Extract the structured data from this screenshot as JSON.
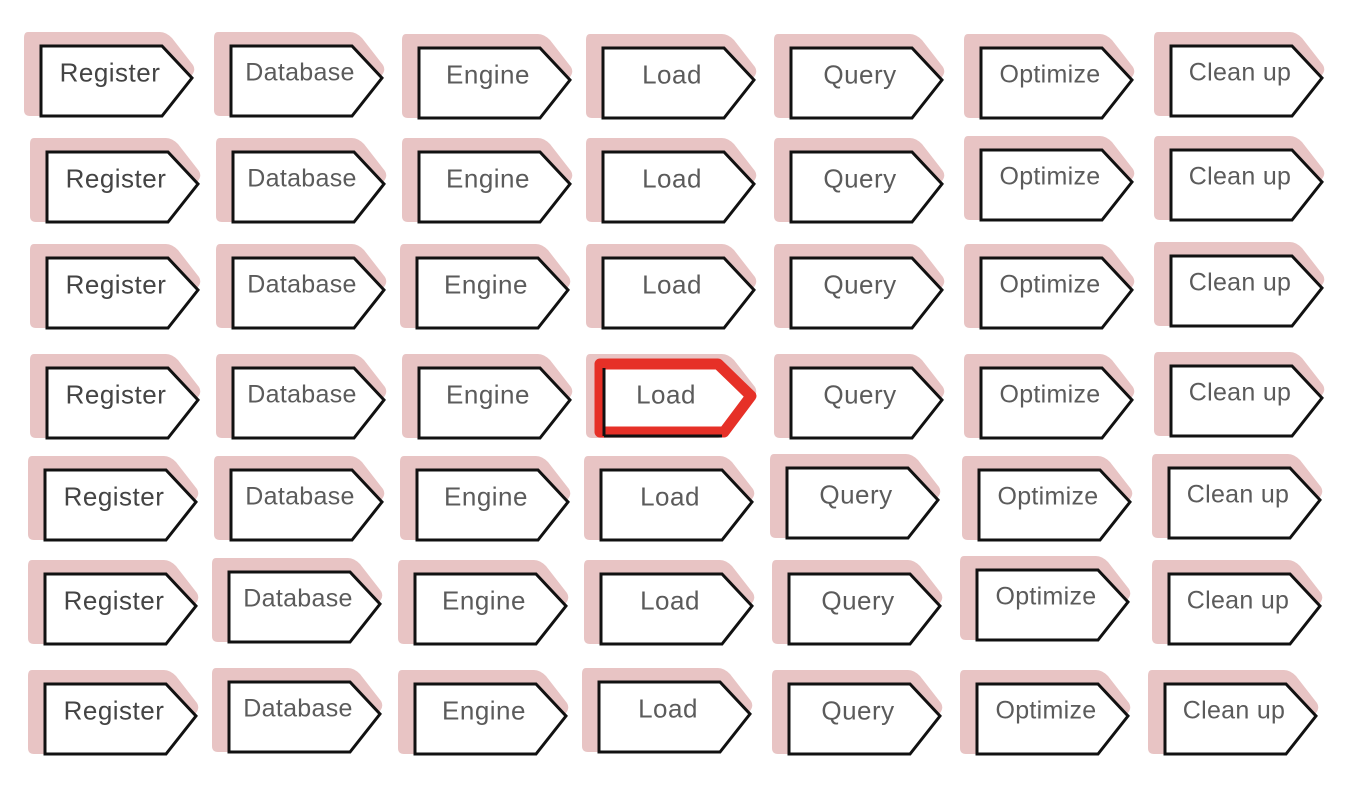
{
  "colors": {
    "shadow": "#e8c4c4",
    "outline": "#111111",
    "selected_outline": "#e63027",
    "label": "#5b5b5b"
  },
  "icon": "pentagon-arrow-tag-icon",
  "columns": [
    "Register",
    "Database",
    "Engine",
    "Load",
    "Query",
    "Optimize",
    "Clean up"
  ],
  "rows": [
    [
      "Register",
      "Database",
      "Engine",
      "Load",
      "Query",
      "Optimize",
      "Clean up"
    ],
    [
      "Register",
      "Database",
      "Engine",
      "Load",
      "Query",
      "Optimize",
      "Clean up"
    ],
    [
      "Register",
      "Database",
      "Engine",
      "Load",
      "Query",
      "Optimize",
      "Clean up"
    ],
    [
      "Register",
      "Database",
      "Engine",
      "Load",
      "Query",
      "Optimize",
      "Clean up"
    ],
    [
      "Register",
      "Database",
      "Engine",
      "Load",
      "Query",
      "Optimize",
      "Clean up"
    ],
    [
      "Register",
      "Database",
      "Engine",
      "Load",
      "Query",
      "Optimize",
      "Clean up"
    ],
    [
      "Register",
      "Database",
      "Engine",
      "Load",
      "Query",
      "Optimize",
      "Clean up"
    ]
  ],
  "selected": {
    "row": 4,
    "column": 4,
    "label": "Load"
  }
}
